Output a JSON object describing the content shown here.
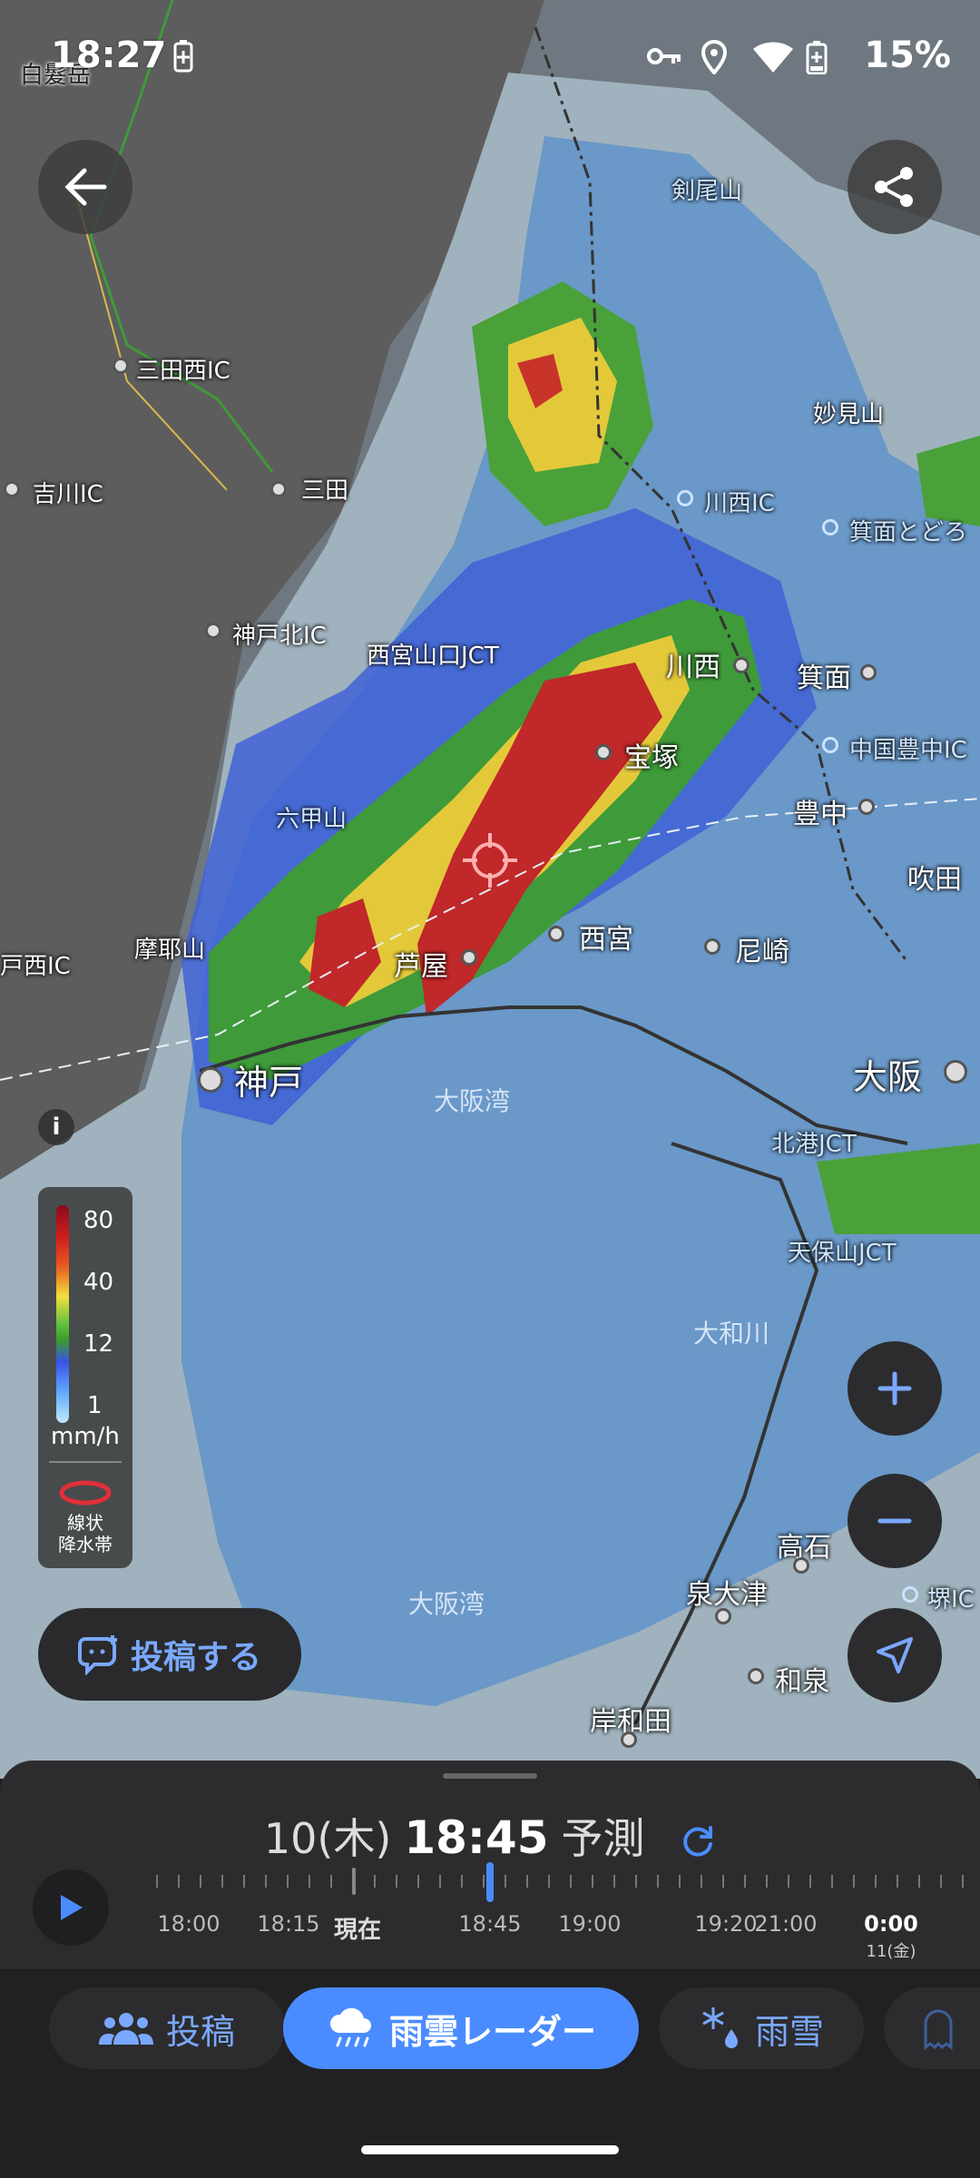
{
  "status": {
    "time": "18:27",
    "battery": "15%"
  },
  "map": {
    "places": {
      "shirakami": "白髮岳",
      "kenbisan": "剣尾山",
      "sandanishi_ic": "三田西IC",
      "myokensan": "妙見山",
      "yokawa_ic": "吉川IC",
      "sanda": "三田",
      "kawanishi_ic": "川西IC",
      "mino_toro": "箕面とどろ",
      "kobekita_ic": "神戸北IC",
      "nishinomiya_jct": "西宮山口JCT",
      "kawanishi": "川西",
      "mino": "箕面",
      "takarazuka": "宝塚",
      "chugoku_toyonaka": "中国豊中IC",
      "rokkosan": "六甲山",
      "toyonaka": "豊中",
      "suita": "吹田",
      "mayasan": "摩耶山",
      "ashiya": "芦屋",
      "nishinomiya": "西宮",
      "amagasaki": "尼崎",
      "suma_ic": "戸西IC",
      "kobe": "神戸",
      "osaka": "大阪",
      "osakawan1": "大阪湾",
      "kitatsu_jct": "北港JCT",
      "tenpozan_jct": "天保山JCT",
      "yamatogawa": "大和川",
      "takaishi": "高石",
      "osakawan2": "大阪湾",
      "izumiotsu": "泉大津",
      "sakai_ic": "堺IC",
      "izumi": "和泉",
      "kishiwada": "岸和田"
    }
  },
  "legend": {
    "v80": "80",
    "v40": "40",
    "v12": "12",
    "v1": "1",
    "unit": "mm/h",
    "linear_line1": "線状",
    "linear_line2": "降水帯"
  },
  "post_button": "投稿する",
  "timeline": {
    "date": "10(木)",
    "time": "18:45",
    "mode": "予測",
    "labels": {
      "t1800": "18:00",
      "t1815": "18:15",
      "now": "現在",
      "t1845": "18:45",
      "t1900": "19:00",
      "t1920": "19:20",
      "t2100": "21:00",
      "t0000": "0:00",
      "next_day": "11(金)"
    }
  },
  "tabs": {
    "post": "投稿",
    "radar": "雨雲レーダー",
    "snow": "雨雪"
  },
  "colors": {
    "accent": "#4a8cff",
    "panel": "#2c2c2e",
    "heavy_rain": "#c0282a",
    "moderate_rain": "#e6c53a",
    "light_rain": "#4f9a3a"
  }
}
